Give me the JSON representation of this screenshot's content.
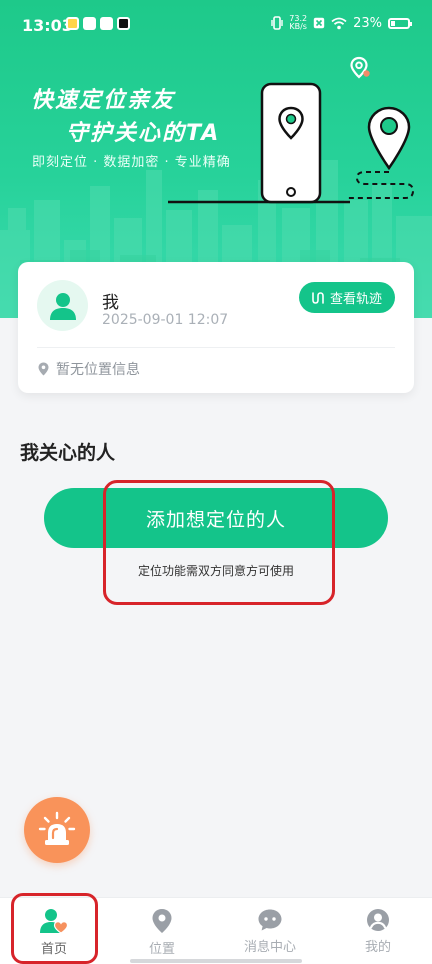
{
  "status_bar": {
    "time": "13:03",
    "net_speed_value": "73.2",
    "net_speed_unit": "KB/s",
    "battery": "23%"
  },
  "hero": {
    "slogan_line1": "快速定位亲友",
    "slogan_line2": "守护关心的TA",
    "features": "即刻定位 · 数据加密 · 专业精确"
  },
  "self_card": {
    "name": "我",
    "timestamp": "2025-09-01 12:07",
    "track_button": "查看轨迹",
    "location": "暂无位置信息"
  },
  "cared": {
    "title": "我关心的人",
    "add_button": "添加想定位的人",
    "hint": "定位功能需双方同意方可使用"
  },
  "nav": {
    "items": [
      {
        "label": "首页",
        "icon": "home-person-heart-icon",
        "active": true
      },
      {
        "label": "位置",
        "icon": "location-pin-icon",
        "active": false
      },
      {
        "label": "消息中心",
        "icon": "chat-bubble-icon",
        "active": false
      },
      {
        "label": "我的",
        "icon": "profile-icon",
        "active": false
      }
    ]
  },
  "colors": {
    "brand_green": "#14c48a",
    "hero_gradient_top": "#1ec98a",
    "sos_orange": "#f9935a",
    "annotation_red": "#d7242a"
  }
}
